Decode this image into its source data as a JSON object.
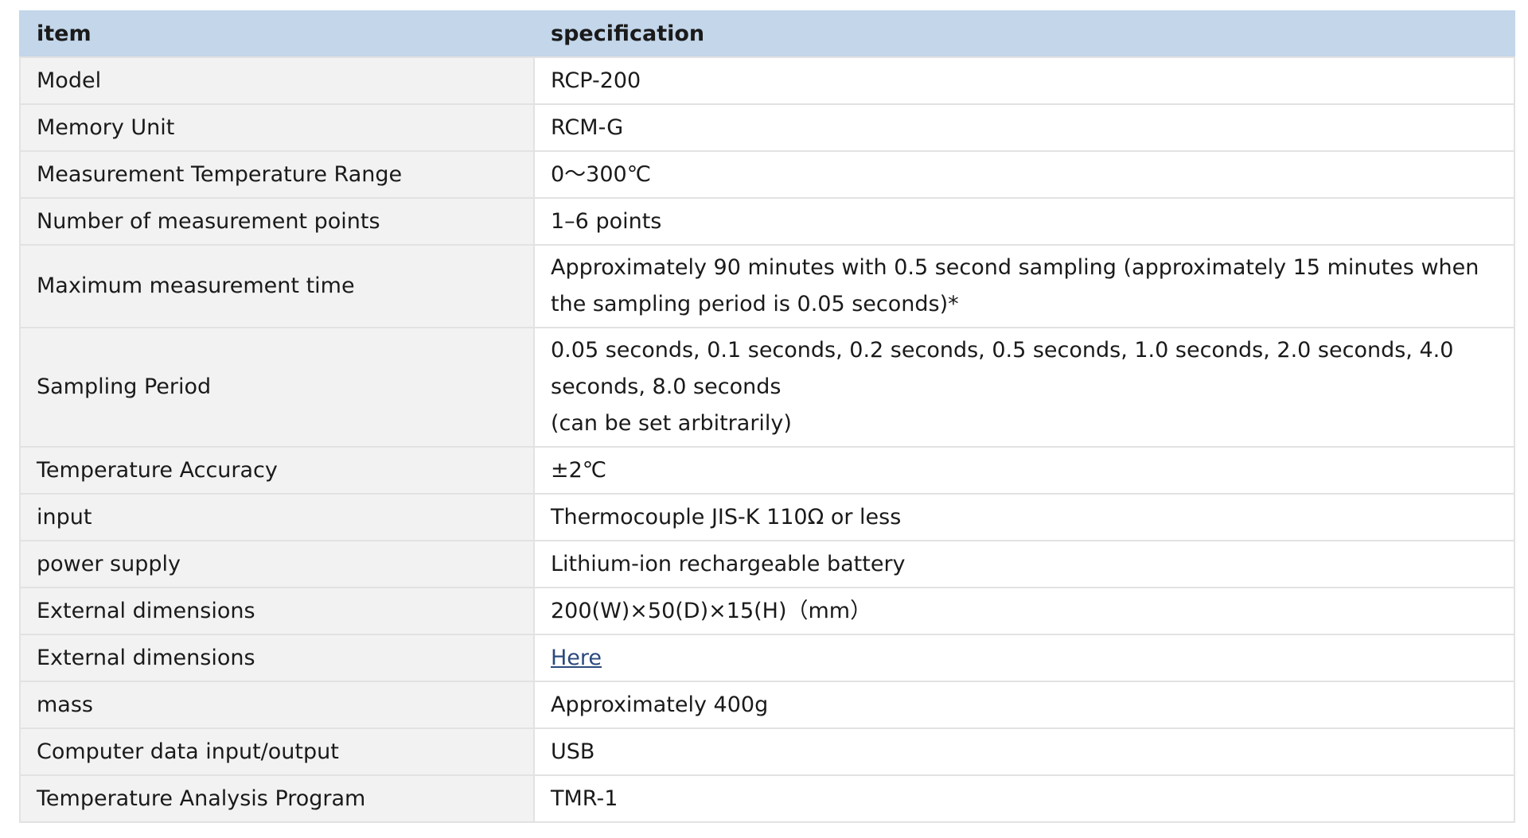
{
  "table": {
    "header": {
      "item": "item",
      "specification": "specification"
    },
    "rows": [
      {
        "item": "Model",
        "spec": [
          "RCP-200"
        ]
      },
      {
        "item": "Memory Unit",
        "spec": [
          "RCM-G"
        ]
      },
      {
        "item": "Measurement Temperature Range",
        "spec": [
          "0～300℃"
        ]
      },
      {
        "item": "Number of measurement points",
        "spec": [
          "1–6 points"
        ]
      },
      {
        "item": "Maximum measurement time",
        "spec": [
          "Approximately 90 minutes with 0.5 second sampling (approximately 15 minutes when",
          "the sampling period is 0.05 seconds)*"
        ]
      },
      {
        "item": "Sampling Period",
        "spec": [
          "0.05 seconds, 0.1 seconds, 0.2 seconds, 0.5 seconds, 1.0 seconds, 2.0 seconds, 4.0",
          "seconds, 8.0 seconds",
          "(can be set arbitrarily)"
        ]
      },
      {
        "item": "Temperature Accuracy",
        "spec": [
          "±2℃"
        ]
      },
      {
        "item": "input",
        "spec": [
          "Thermocouple JIS-K 110Ω or less"
        ]
      },
      {
        "item": "power supply",
        "spec": [
          "Lithium-ion rechargeable battery"
        ]
      },
      {
        "item": "External dimensions",
        "spec": [
          "200(W)×50(D)×15(H)（mm）"
        ]
      },
      {
        "item": "External dimensions",
        "link": "Here"
      },
      {
        "item": "mass",
        "spec": [
          "Approximately 400g"
        ]
      },
      {
        "item": "Computer data input/output",
        "spec": [
          "USB"
        ]
      },
      {
        "item": "Temperature Analysis Program",
        "spec": [
          "TMR-1"
        ]
      }
    ]
  },
  "colors": {
    "header_bg": "#c3d6ea",
    "key_cell_bg": "#f2f2f2",
    "border": "#e2e2e2",
    "link": "#2b4a7d"
  }
}
